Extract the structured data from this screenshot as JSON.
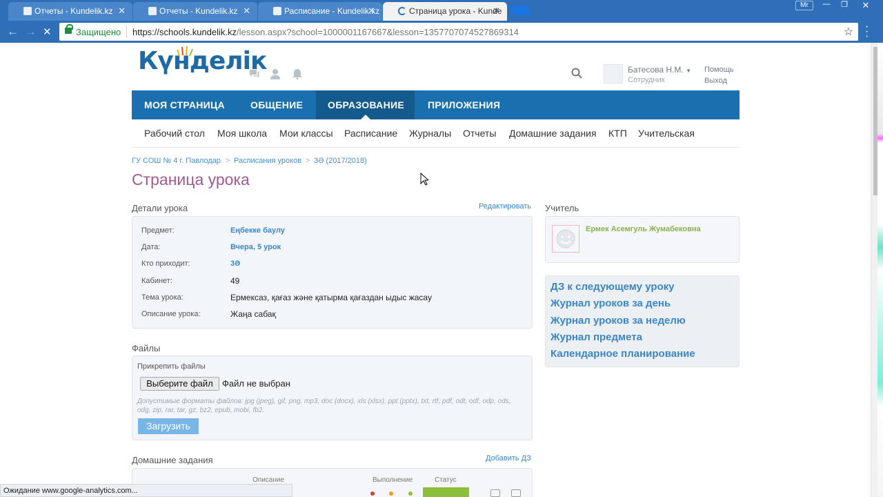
{
  "browser": {
    "tabs": [
      {
        "label": "Отчеты - Kundelik.kz"
      },
      {
        "label": "Отчеты - Kundelik.kz"
      },
      {
        "label": "Расписание - Kundelik.kz"
      },
      {
        "label": "Страница урока - Kundе"
      }
    ],
    "profile": "Mr",
    "secure_label": "Защищено",
    "url_host": "https://schools.kundelik.kz",
    "url_path": "/lesson.aspx?school=1000001167667&lesson=1357707074527869314",
    "status_text": "Ожидание www.google-analytics.com..."
  },
  "header": {
    "logo_text": "Күнделік",
    "user_name": "Батесова Н.М.",
    "user_role": "Сотрудник",
    "help_label": "Помощь",
    "logout_label": "Выход"
  },
  "main_nav": [
    "МОЯ СТРАНИЦА",
    "ОБЩЕНИЕ",
    "ОБРАЗОВАНИЕ",
    "ПРИЛОЖЕНИЯ"
  ],
  "sub_nav": [
    "Рабочий стол",
    "Моя школа",
    "Мои классы",
    "Расписание",
    "Журналы",
    "Отчеты",
    "Домашние задания",
    "КТП",
    "Учительская"
  ],
  "breadcrumb": [
    "ГУ СОШ № 4 г. Павлодар",
    "Расписания уроков",
    "3Ә (2017/2018)"
  ],
  "breadcrumb_sep": ">",
  "page_title": "Страница урока",
  "details": {
    "title": "Детали урока",
    "edit_label": "Редактировать",
    "rows": [
      {
        "label": "Предмет:",
        "value": "Еңбекке баулу"
      },
      {
        "label": "Дата:",
        "value": "Вчера, 5 урок"
      },
      {
        "label": "Кто приходит:",
        "value": "3Ә"
      },
      {
        "label": "Кабинет:",
        "value": "49"
      },
      {
        "label": "Тема урока:",
        "value": "Ермексаз, қағаз және қатырма қағаздан ыдыс жасау"
      },
      {
        "label": "Описание урока:",
        "value": "Жаңа сабақ"
      }
    ]
  },
  "teacher": {
    "title": "Учитель",
    "name": "Ермек Асемгуль Жумабековна"
  },
  "quick_links": [
    "ДЗ к следующему уроку",
    "Журнал уроков за день",
    "Журнал уроков за неделю",
    "Журнал предмета",
    "Календарное планирование"
  ],
  "files": {
    "title": "Файлы",
    "attach_label": "Прикрепить файлы",
    "choose_button": "Выберите файл",
    "no_file": "Файл не выбран",
    "formats": "Допустимые форматы файлов: jpg (jpeg), gif, png, mp3, doc (docx), xls (xlsx), ppt (pptx), txt, rtf, pdf, odt, odf, odp, ods, odg, zip, rar, tar, gz, bz2, epub, mobi, fb2.",
    "upload_button": "Загрузить"
  },
  "homework": {
    "title": "Домашние задания",
    "add_label": "Добавить ДЗ",
    "columns": [
      "Описание",
      "Выполнение",
      "Статус"
    ]
  }
}
